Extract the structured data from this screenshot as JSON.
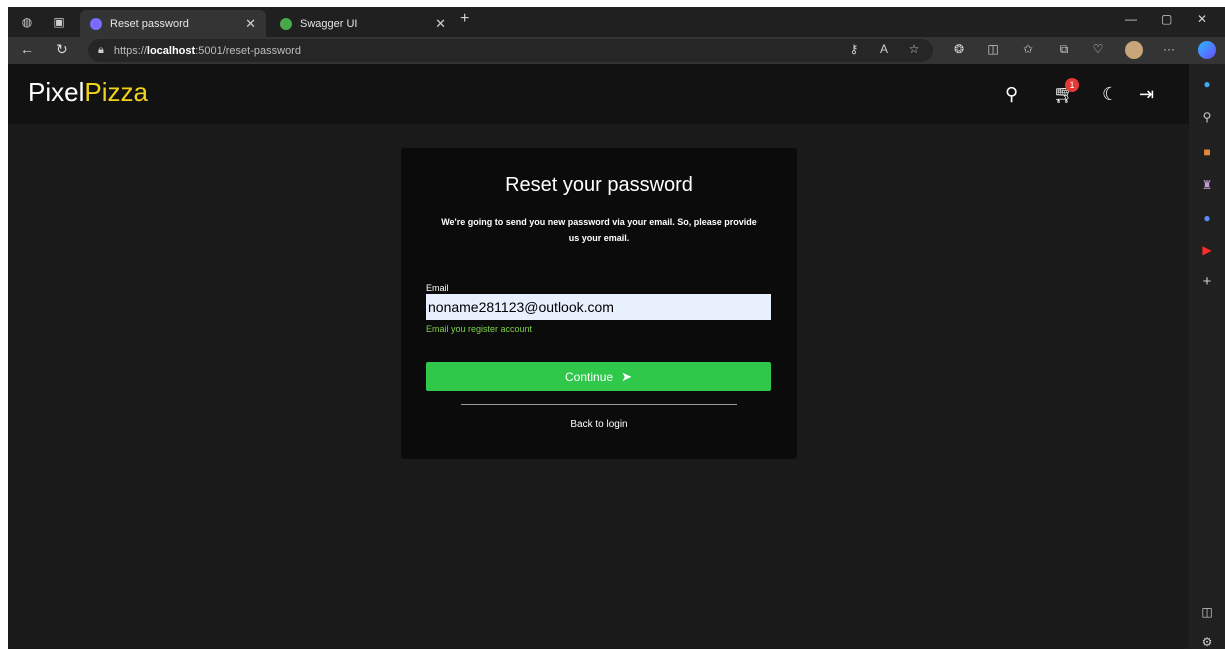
{
  "browser": {
    "tabs": [
      {
        "title": "Reset password",
        "close": "✕"
      },
      {
        "title": "Swagger UI",
        "close": "✕"
      }
    ],
    "new_tab": "+",
    "url_prefix": "https://",
    "url_host": "localhost",
    "url_path": ":5001/reset-password",
    "more": "···"
  },
  "app": {
    "brand_first": "Pixel",
    "brand_second": "Pizza",
    "cart_count": "1"
  },
  "card": {
    "title": "Reset your password",
    "description": "We're going to send you new password via your email. So, please provide us your email.",
    "email_label": "Email",
    "email_value": "noname281123@outlook.com",
    "email_hint": "Email you register account",
    "continue_label": "Continue",
    "back_label": "Back to login"
  },
  "colors": {
    "accent_yellow": "#f2d21b",
    "button_green": "#2fc84a",
    "hint_green": "#7ed348",
    "badge_red": "#e53935"
  }
}
